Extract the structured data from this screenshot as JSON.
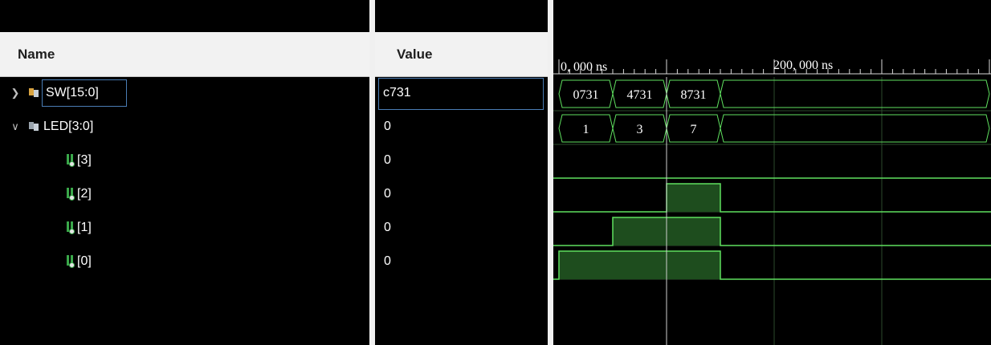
{
  "columns": {
    "name": "Name",
    "value": "Value"
  },
  "signals": [
    {
      "name": "SW[15:0]",
      "value": "c731",
      "kind": "bus",
      "expanded": false,
      "selected": true
    },
    {
      "name": "LED[3:0]",
      "value": "0",
      "kind": "bus",
      "expanded": true,
      "selected": false
    },
    {
      "name": "[3]",
      "value": "0",
      "kind": "bit"
    },
    {
      "name": "[2]",
      "value": "0",
      "kind": "bit"
    },
    {
      "name": "[1]",
      "value": "0",
      "kind": "bit"
    },
    {
      "name": "[0]",
      "value": "0",
      "kind": "bit"
    }
  ],
  "timeline": {
    "labels": [
      {
        "text": "0, 000 ns",
        "time_ns": 0
      },
      {
        "text": "200, 000 ns",
        "time_ns": 200
      }
    ],
    "cursor_ns": 100
  },
  "waves": {
    "SW": [
      {
        "from": 0,
        "to": 50,
        "text": "0731"
      },
      {
        "from": 50,
        "to": 100,
        "text": "4731"
      },
      {
        "from": 100,
        "to": 150,
        "text": "8731"
      },
      {
        "from": 150,
        "to": 400,
        "text": ""
      }
    ],
    "LED": [
      {
        "from": 0,
        "to": 50,
        "text": "1"
      },
      {
        "from": 50,
        "to": 100,
        "text": "3"
      },
      {
        "from": 100,
        "to": 150,
        "text": "7"
      },
      {
        "from": 150,
        "to": 400,
        "text": ""
      }
    ],
    "bits": [
      {
        "name": "[3]",
        "high": []
      },
      {
        "name": "[2]",
        "high": [
          [
            100,
            150
          ]
        ]
      },
      {
        "name": "[1]",
        "high": [
          [
            50,
            150
          ]
        ]
      },
      {
        "name": "[0]",
        "high": [
          [
            0,
            150
          ]
        ]
      }
    ]
  },
  "colors": {
    "wave": "#5fe05f",
    "high_fill": "#1e4d1e",
    "grid": "#2c4a2c",
    "cursor": "#cfcfcf",
    "text": "#ffffff",
    "accent": "#4a7db5"
  }
}
